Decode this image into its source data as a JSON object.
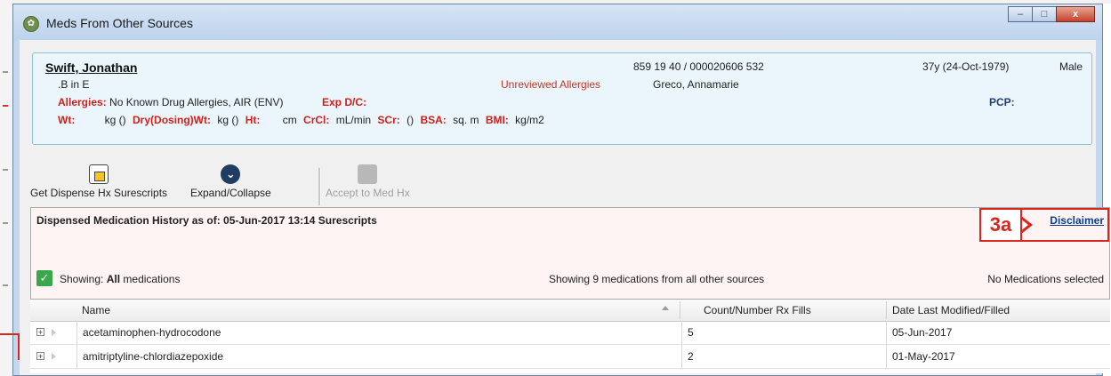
{
  "window": {
    "title": "Meds From Other Sources",
    "controls": {
      "minimize": "–",
      "maximize": "□",
      "close": "x"
    }
  },
  "patient": {
    "name": "Swift, Jonathan",
    "sub": ".B in E",
    "unreviewed": "Unreviewed Allergies",
    "id": "859 19 40 / 000020606  532",
    "doctor": "Greco, Annamarie",
    "age": "37y (24-Oct-1979)",
    "gender": "Male",
    "allergies_label": "Allergies:",
    "allergies_value": "No Known Drug Allergies, AIR (ENV)",
    "expdc_label": "Exp D/C:",
    "pcp_label": "PCP:",
    "vitals": {
      "wt_label": "Wt:",
      "wt_unit": "kg ()",
      "drywt_label": "Dry(Dosing)Wt:",
      "drywt_unit": "kg ()",
      "ht_label": "Ht:",
      "ht_unit": "cm",
      "crcl_label": "CrCl:",
      "crcl_unit": "mL/min",
      "scr_label": "SCr:",
      "scr_unit": "()",
      "bsa_label": "BSA:",
      "bsa_unit": "sq. m",
      "bmi_label": "BMI:",
      "bmi_unit": "kg/m2"
    }
  },
  "toolbar": {
    "get_dispense": "Get Dispense Hx Surescripts",
    "expand_collapse": "Expand/Collapse",
    "accept": "Accept to Med Hx"
  },
  "history": {
    "heading": "Dispensed Medication History as of:  05-Jun-2017 13:14 Surescripts",
    "disclaimer": "Disclaimer",
    "callout": "3a",
    "showing_prefix": "Showing:",
    "showing_value": "All",
    "showing_suffix": "medications",
    "showing_count": "Showing 9 medications from all other sources",
    "selected": "No Medications selected"
  },
  "grid": {
    "columns": [
      "Name",
      "Count/Number Rx Fills",
      "Date Last Modified/Filled"
    ],
    "rows": [
      {
        "name": "acetaminophen-hydrocodone",
        "count": "5",
        "date": "05-Jun-2017"
      },
      {
        "name": "amitriptyline-chlordiazepoxide",
        "count": "2",
        "date": "01-May-2017"
      }
    ]
  },
  "colors": {
    "allergy_red": "#d0201a",
    "callout_red": "#d9261f",
    "link_blue": "#0b3d91",
    "check_green": "#3aa84a"
  }
}
